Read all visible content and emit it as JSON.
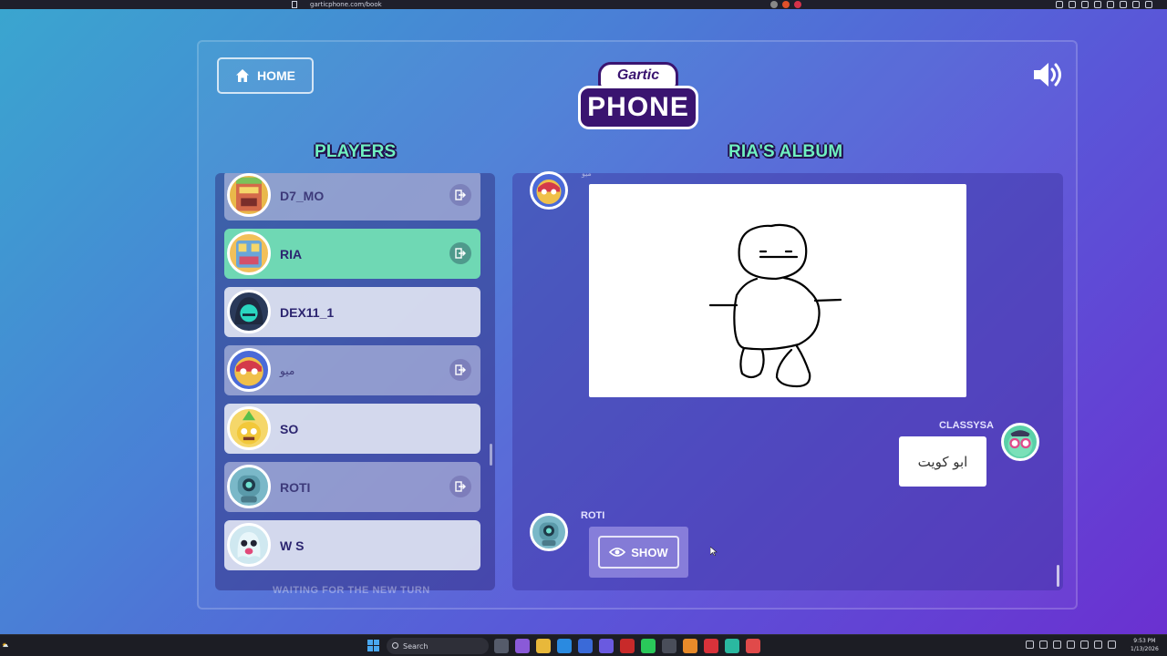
{
  "browser": {
    "url": "garticphone.com/book"
  },
  "header": {
    "home_label": "HOME",
    "logo_top": "Gartic",
    "logo_bottom": "PHONE"
  },
  "players": {
    "heading": "PLAYERS",
    "waiting_text": "WAITING FOR THE NEW TURN",
    "items": [
      {
        "name": "D7_MO",
        "state": "dim",
        "kick": true
      },
      {
        "name": "RIA",
        "state": "active",
        "kick": true
      },
      {
        "name": "DEX11_1",
        "state": "normal",
        "kick": false
      },
      {
        "name": "ميو",
        "state": "dim",
        "kick": true
      },
      {
        "name": "SO",
        "state": "normal",
        "kick": false
      },
      {
        "name": "ROTI",
        "state": "dim",
        "kick": true
      },
      {
        "name": "W S",
        "state": "normal",
        "kick": false
      }
    ]
  },
  "album": {
    "heading": "RIA'S ALBUM",
    "drawing_author": "ميو",
    "guess_author": "CLASSYSA",
    "guess_text": "ابو كويت",
    "next_author": "ROTI",
    "show_label": "SHOW"
  },
  "taskbar": {
    "search_label": "Search",
    "time": "9:53 PM",
    "date": "1/13/2026"
  },
  "colors": {
    "accent_heading": "#6ff0c0",
    "active_row": "#6fd8b4",
    "logo_purple": "#3a1470"
  }
}
